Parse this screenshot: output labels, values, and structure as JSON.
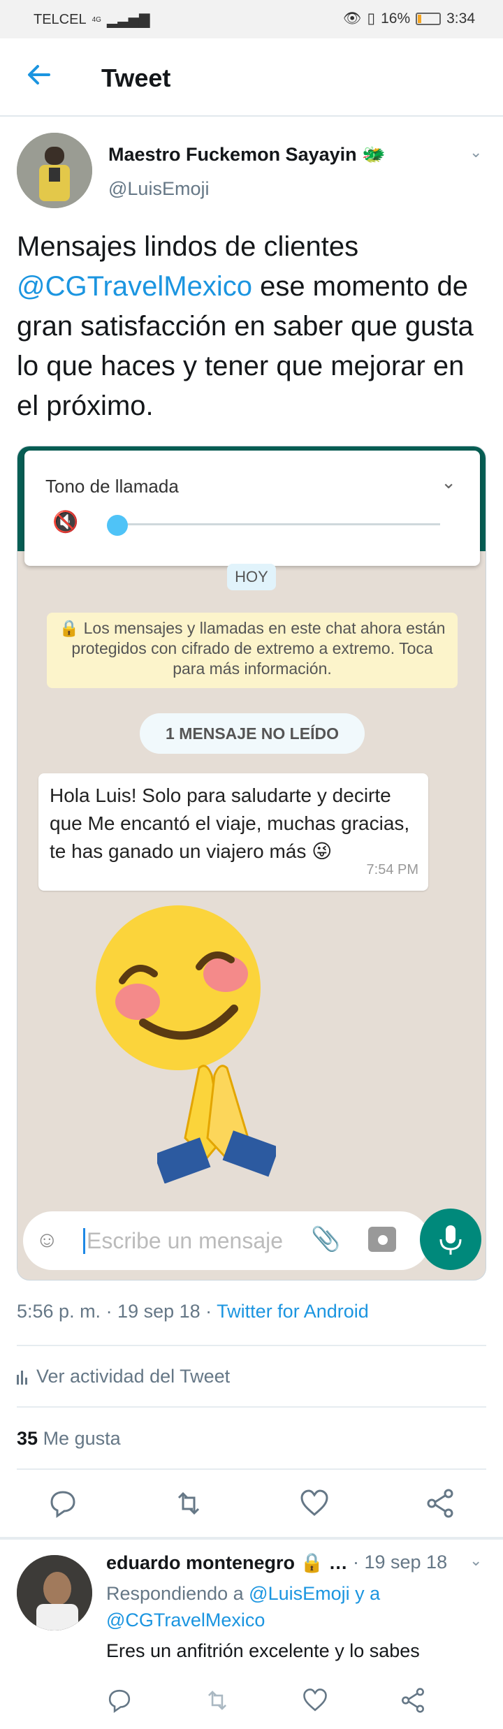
{
  "statusbar": {
    "carrier": "TELCEL",
    "network": "4G",
    "battery": "16%",
    "battery_level": 0.16,
    "time": "3:34"
  },
  "header": {
    "title": "Tweet"
  },
  "tweet": {
    "author_name": "Maestro Fuckemon Sayayin 🐲",
    "author_handle": "@LuisEmoji",
    "text_before": "Mensajes lindos de clientes ",
    "mention": "@CGTravelMexico",
    "text_after": " ese momento de gran satisfacción en saber que gusta lo que haces y tener que mejorar en el próximo.",
    "timestamp": "5:56 p. m. · 19 sep 18 · ",
    "source": "Twitter for Android",
    "activity_label": "Ver actividad del Tweet",
    "likes_count": "35",
    "likes_label": "Me gusta"
  },
  "screenshot": {
    "ringtone_label": "Tono de llamada",
    "date_chip": "HOY",
    "encryption_notice": "🔒 Los mensajes y llamadas en este chat ahora están protegidos con cifrado de extremo a extremo. Toca para más información.",
    "unread_label": "1 MENSAJE NO LEÍDO",
    "message": "Hola Luis! Solo para saludarte y decirte que Me encantó el viaje, muchas gracias, te has ganado un viajero más 😜",
    "message_time": "7:54 PM",
    "input_placeholder": "Escribe un mensaje"
  },
  "reply": {
    "name": "eduardo montenegro 🔒 …",
    "date": "· 19 sep 18",
    "replying_prefix": "Respondiendo a ",
    "replying_to": "@LuisEmoji y a @CGTravelMexico",
    "text": "Eres un anfitrión excelente y lo sabes"
  },
  "colors": {
    "accent": "#1b95e0",
    "whatsapp_green": "#075e54",
    "mic_green": "#00897b"
  }
}
